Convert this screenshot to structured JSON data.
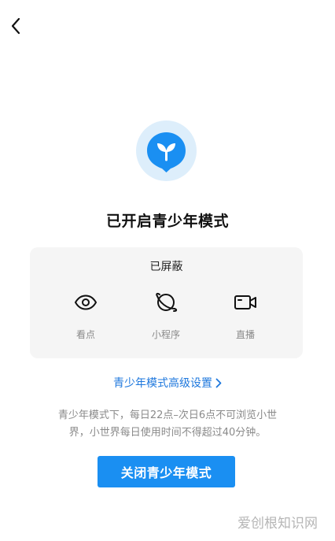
{
  "nav": {
    "back_icon": "back-arrow-icon"
  },
  "mode_logo": {
    "icon": "sprout-shield-icon",
    "color": "#1a8ff2",
    "halo": "#ddeefb"
  },
  "title": "已开启青少年模式",
  "blocked": {
    "title": "已屏蔽",
    "items": [
      {
        "label": "看点",
        "icon": "eye-icon"
      },
      {
        "label": "小程序",
        "icon": "mini-program-icon"
      },
      {
        "label": "直播",
        "icon": "video-camera-icon"
      }
    ]
  },
  "advanced_link": {
    "label": "青少年模式高级设置",
    "icon": "chevron-right-icon"
  },
  "description": {
    "line1": "青少年模式下，每日22点–次日6点不可浏览小世",
    "line2": "界，小世界每日使用时间不得超过40分钟。"
  },
  "close_button": {
    "label": "关闭青少年模式",
    "color": "#1a8ff2"
  },
  "watermark": "爱创根知识网"
}
